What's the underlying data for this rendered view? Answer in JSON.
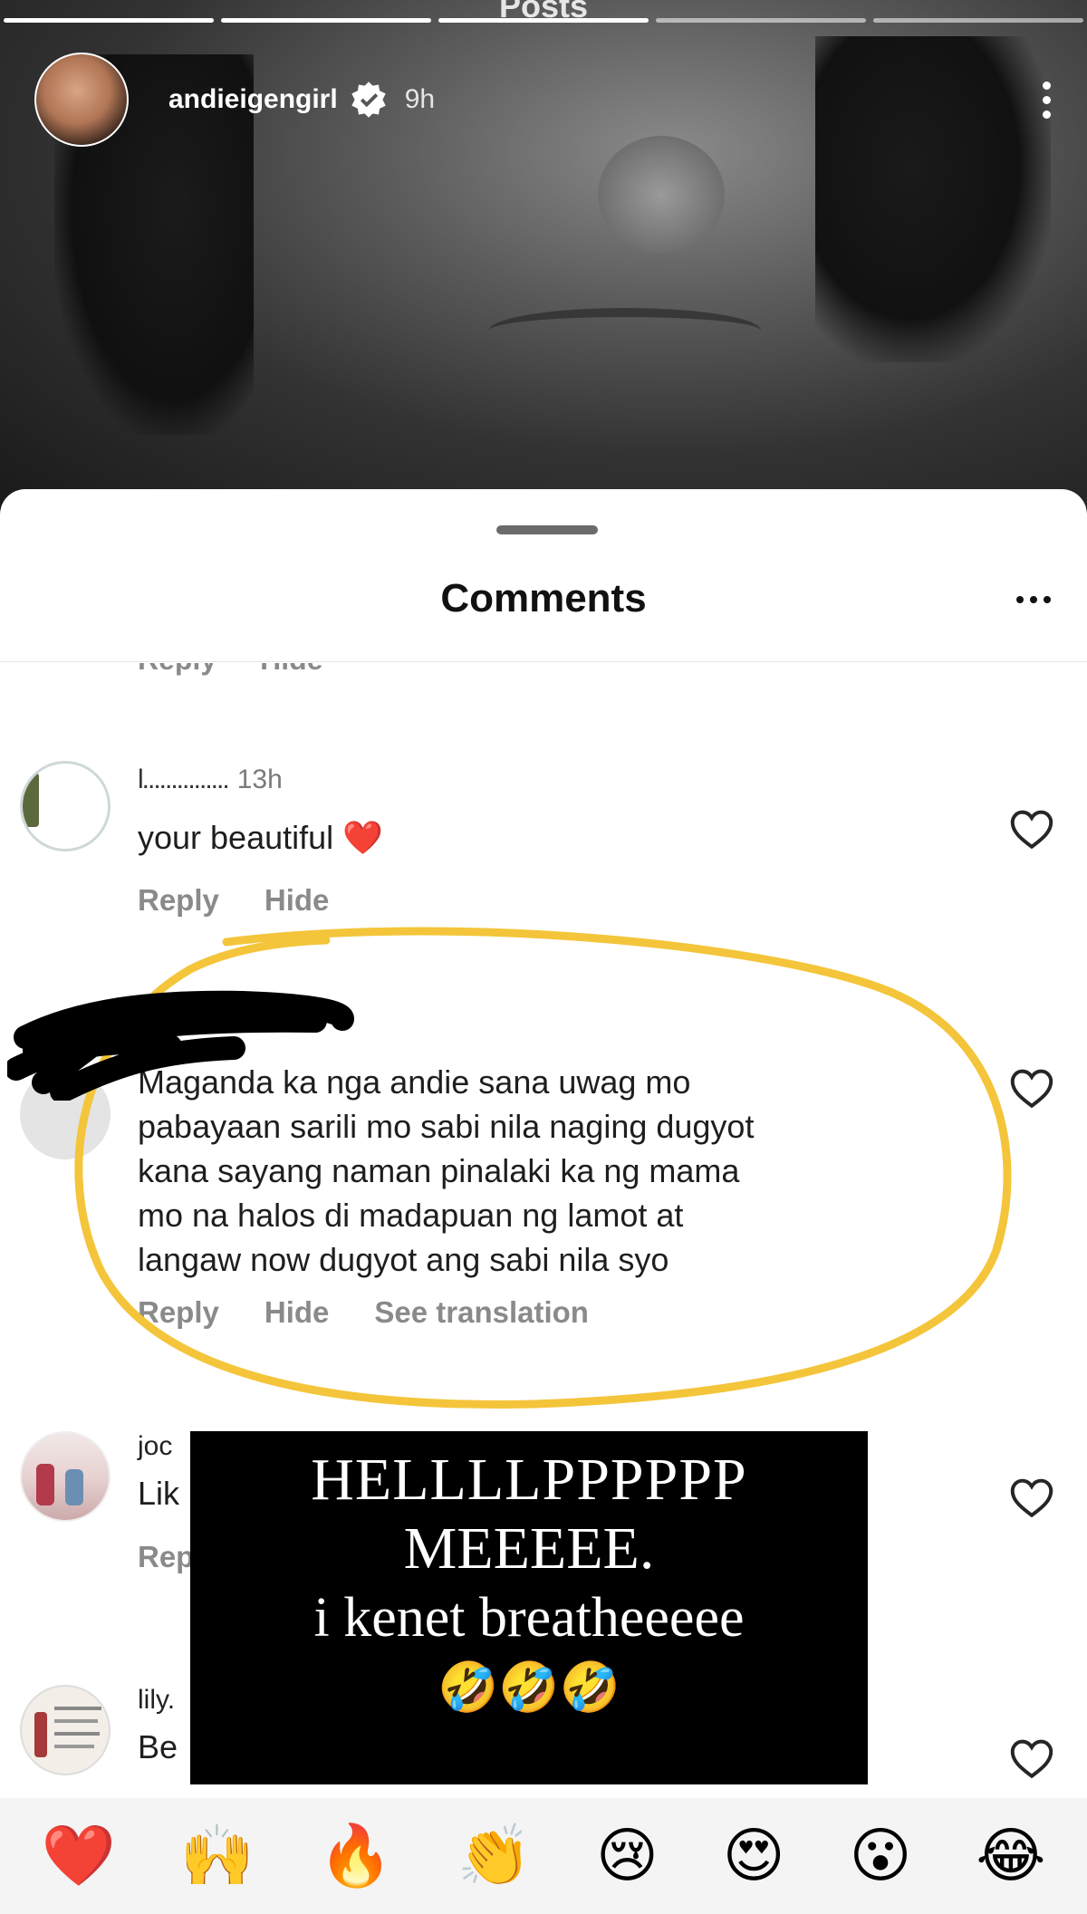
{
  "story": {
    "screen_title": "Posts",
    "username": "andieigengirl",
    "time": "9h"
  },
  "sheet": {
    "title": "Comments",
    "cut_actions": [
      "Reply",
      "Hide"
    ]
  },
  "comments": [
    {
      "username": "l...............",
      "time": "13h",
      "text": "your beautiful ❤️",
      "actions": [
        "Reply",
        "Hide"
      ]
    },
    {
      "username": "",
      "time": "",
      "text_lines": [
        "Maganda ka nga andie sana uwag mo",
        "pabayaan sarili mo sabi nila naging dugyot",
        "kana sayang naman pinalaki ka ng mama",
        "mo na halos di madapuan ng lamot at",
        "langaw now dugyot ang sabi nila syo"
      ],
      "actions": [
        "Reply",
        "Hide",
        "See translation"
      ]
    },
    {
      "username": "joc",
      "text": "Lik",
      "actions": [
        "Rep"
      ]
    },
    {
      "username": "lily.",
      "text": "Be"
    }
  ],
  "overlay": {
    "line1": "HELLLLPPPPPP",
    "line2": "MEEEEE.",
    "line3": "i kenet breatheeeee",
    "line4": "🤣🤣🤣"
  },
  "reactions": [
    "❤️",
    "🙌",
    "🔥",
    "👏",
    "😢",
    "😍",
    "😮",
    "😂"
  ]
}
